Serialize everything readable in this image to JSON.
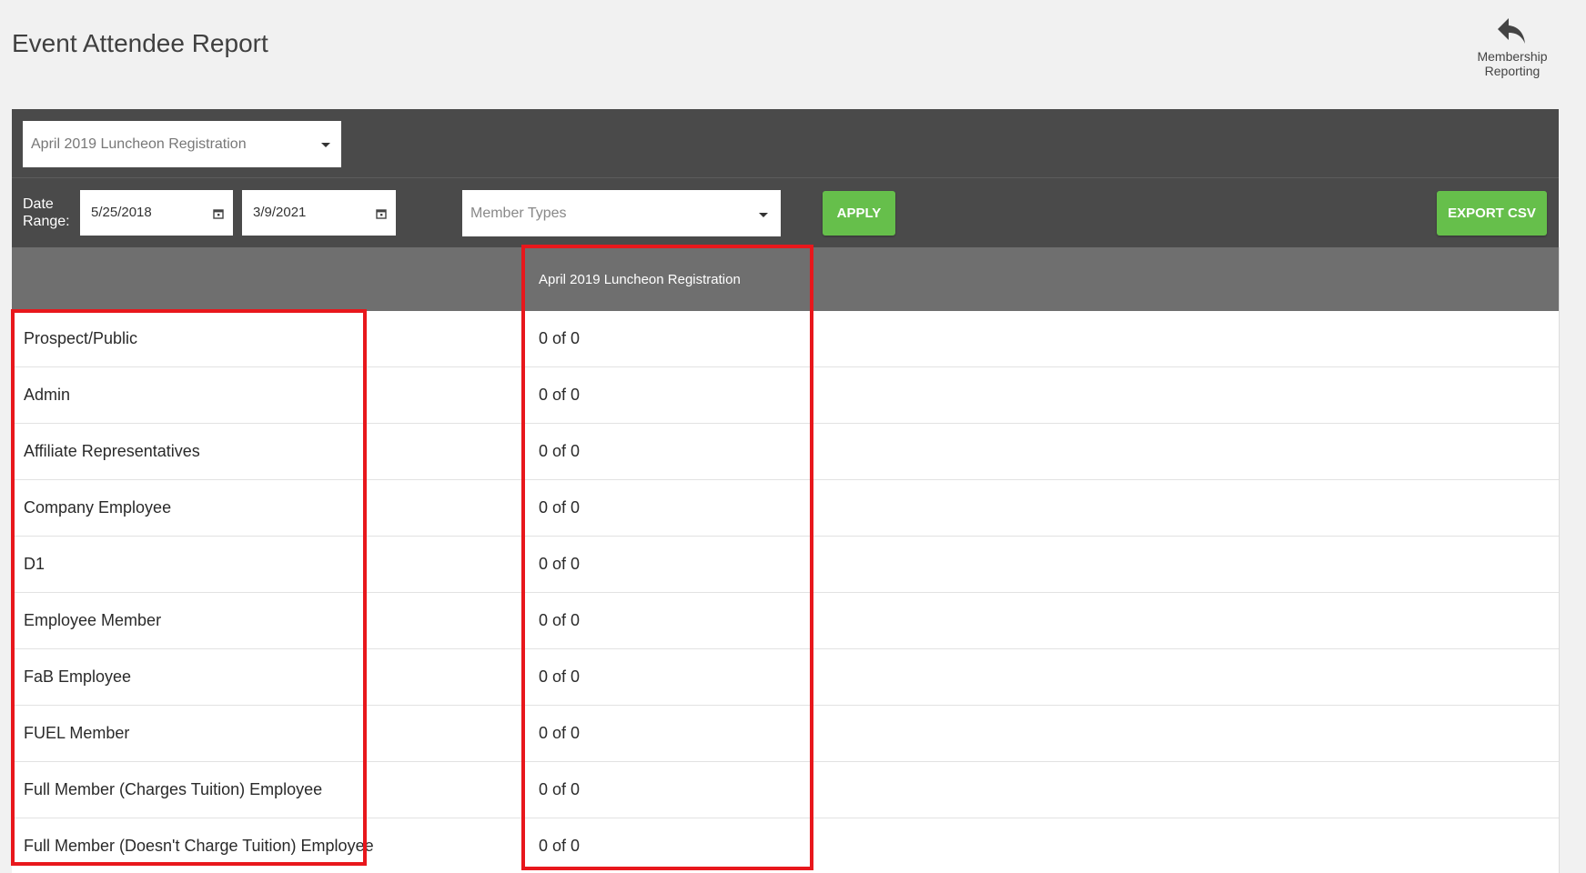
{
  "header": {
    "title": "Event Attendee Report",
    "back_label_line1": "Membership",
    "back_label_line2": "Reporting"
  },
  "filters": {
    "event_select_value": "April 2019 Luncheon Registration",
    "date_range_label_line1": "Date",
    "date_range_label_line2": "Range:",
    "start_date": "5/25/2018",
    "end_date": "3/9/2021",
    "member_types_placeholder": "Member Types",
    "apply_label": "APPLY",
    "export_label": "EXPORT CSV"
  },
  "table": {
    "type_header": "",
    "event_header": "April 2019 Luncheon Registration",
    "rows": [
      {
        "type": "Prospect/Public",
        "count": "0 of 0"
      },
      {
        "type": "Admin",
        "count": "0 of 0"
      },
      {
        "type": "Affiliate Representatives",
        "count": "0 of 0"
      },
      {
        "type": "Company Employee",
        "count": "0 of 0"
      },
      {
        "type": "D1",
        "count": "0 of 0"
      },
      {
        "type": "Employee Member",
        "count": "0 of 0"
      },
      {
        "type": "FaB Employee",
        "count": "0 of 0"
      },
      {
        "type": "FUEL Member",
        "count": "0 of 0"
      },
      {
        "type": "Full Member (Charges Tuition) Employee",
        "count": "0 of 0"
      },
      {
        "type": "Full Member (Doesn't Charge Tuition) Employee",
        "count": "0 of 0"
      }
    ]
  },
  "colors": {
    "panel_bg": "#4a4a4a",
    "table_header_bg": "#6f6f6f",
    "button_green": "#66bf4b",
    "highlight_red": "#e8171c"
  }
}
